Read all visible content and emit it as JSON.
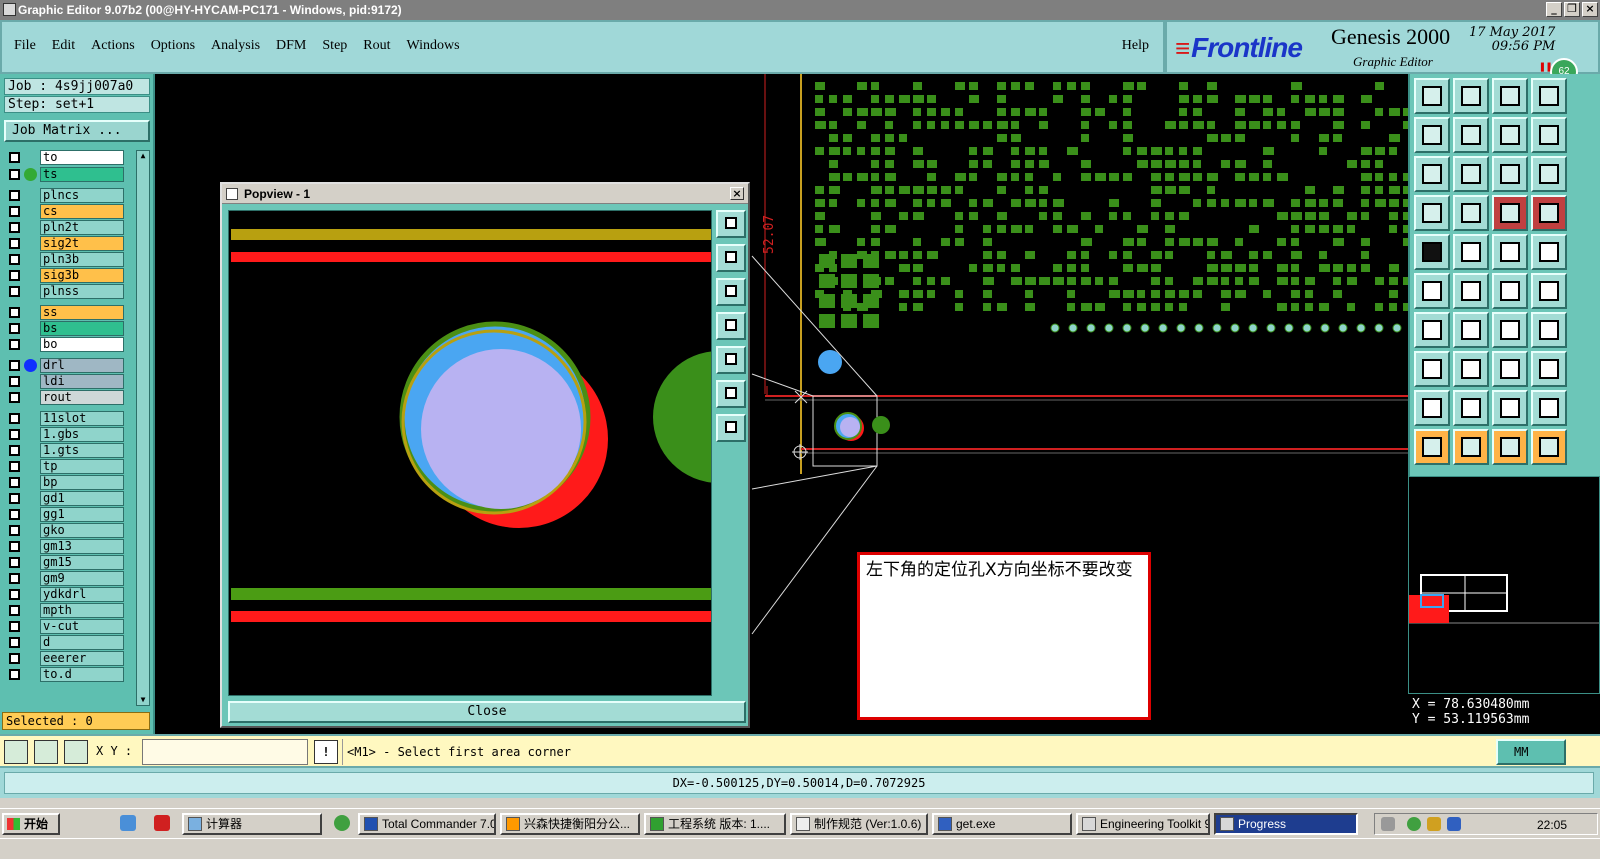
{
  "window": {
    "title": "Graphic Editor 9.07b2 (00@HY-HYCAM-PC171 - Windows, pid:9172)"
  },
  "menu": {
    "items": [
      "File",
      "Edit",
      "Actions",
      "Options",
      "Analysis",
      "DFM",
      "Step",
      "Rout",
      "Windows"
    ],
    "help": "Help"
  },
  "brand": {
    "logo": "Frontline",
    "product": "Genesis 2000",
    "subtitle": "Graphic Editor",
    "date": "17 May 2017",
    "time": "09:56 PM",
    "badge": "62"
  },
  "job": {
    "job_label": "Job : 4s9jj007a0",
    "step_label": "Step: set+1",
    "matrix_button": "Job Matrix ..."
  },
  "layers": [
    {
      "name": "to",
      "color": "#ffffff",
      "dot": ""
    },
    {
      "name": "ts",
      "color": "#2fbf8f",
      "dot": "#33aa33"
    },
    {
      "name": "plncs",
      "color": "#8fd4cb",
      "dot": ""
    },
    {
      "name": "cs",
      "color": "#ffc04a",
      "dot": ""
    },
    {
      "name": "pln2t",
      "color": "#8fd4cb",
      "dot": ""
    },
    {
      "name": "sig2t",
      "color": "#ffc04a",
      "dot": ""
    },
    {
      "name": "pln3b",
      "color": "#8fd4cb",
      "dot": ""
    },
    {
      "name": "sig3b",
      "color": "#ffc04a",
      "dot": ""
    },
    {
      "name": "plnss",
      "color": "#8fd4cb",
      "dot": ""
    },
    {
      "name": "ss",
      "color": "#ffc04a",
      "dot": ""
    },
    {
      "name": "bs",
      "color": "#2fbf8f",
      "dot": ""
    },
    {
      "name": "bo",
      "color": "#ffffff",
      "dot": ""
    },
    {
      "name": "drl",
      "color": "#9fb7c4",
      "dot": "#1030ff"
    },
    {
      "name": "ldi",
      "color": "#9fb7c4",
      "dot": ""
    },
    {
      "name": "rout",
      "color": "#cfd8d8",
      "dot": ""
    },
    {
      "name": "11slot",
      "color": "#8fd4cb",
      "dot": ""
    },
    {
      "name": "1.gbs",
      "color": "#8fd4cb",
      "dot": ""
    },
    {
      "name": "1.gts",
      "color": "#8fd4cb",
      "dot": ""
    },
    {
      "name": "tp",
      "color": "#8fd4cb",
      "dot": ""
    },
    {
      "name": "bp",
      "color": "#8fd4cb",
      "dot": ""
    },
    {
      "name": "gd1",
      "color": "#8fd4cb",
      "dot": ""
    },
    {
      "name": "gg1",
      "color": "#8fd4cb",
      "dot": ""
    },
    {
      "name": "gko",
      "color": "#8fd4cb",
      "dot": ""
    },
    {
      "name": "gm13",
      "color": "#8fd4cb",
      "dot": ""
    },
    {
      "name": "gm15",
      "color": "#8fd4cb",
      "dot": ""
    },
    {
      "name": "gm9",
      "color": "#8fd4cb",
      "dot": ""
    },
    {
      "name": "ydkdrl",
      "color": "#8fd4cb",
      "dot": ""
    },
    {
      "name": "mpth",
      "color": "#8fd4cb",
      "dot": ""
    },
    {
      "name": "v-cut",
      "color": "#8fd4cb",
      "dot": ""
    },
    {
      "name": "d",
      "color": "#8fd4cb",
      "dot": ""
    },
    {
      "name": "eeerer",
      "color": "#8fd4cb",
      "dot": ""
    },
    {
      "name": "to.d",
      "color": "#8fd4cb",
      "dot": ""
    }
  ],
  "selected": "Selected : 0",
  "popview": {
    "title": "Popview - 1",
    "close_button": "Close"
  },
  "canvas": {
    "dimension_label": "52.07"
  },
  "note": {
    "text": "左下角的定位孔X方向坐标不要改变"
  },
  "coords": {
    "x": "X = 78.630480mm",
    "y": "Y = 53.119563mm"
  },
  "command": {
    "xy_label": "X Y :",
    "xy_value": "",
    "warn": "!",
    "prompt": "<M1> - Select first area corner",
    "units": "MM"
  },
  "status": {
    "text": "DX=-0.500125,DY=0.50014,D=0.7072925"
  },
  "taskbar": {
    "start": "开始",
    "tasks": [
      {
        "label": "计算器",
        "active": false
      },
      {
        "label": "Total Commander 7.0...",
        "active": false
      },
      {
        "label": "兴森快捷衡阳分公...",
        "active": false
      },
      {
        "label": "工程系统  版本: 1....",
        "active": false
      },
      {
        "label": "制作规范 (Ver:1.0.6)",
        "active": false
      },
      {
        "label": "get.exe",
        "active": false
      },
      {
        "label": "Engineering Toolkit 9....",
        "active": false
      },
      {
        "label": "Progress",
        "active": true
      }
    ],
    "clock": "22:05"
  }
}
